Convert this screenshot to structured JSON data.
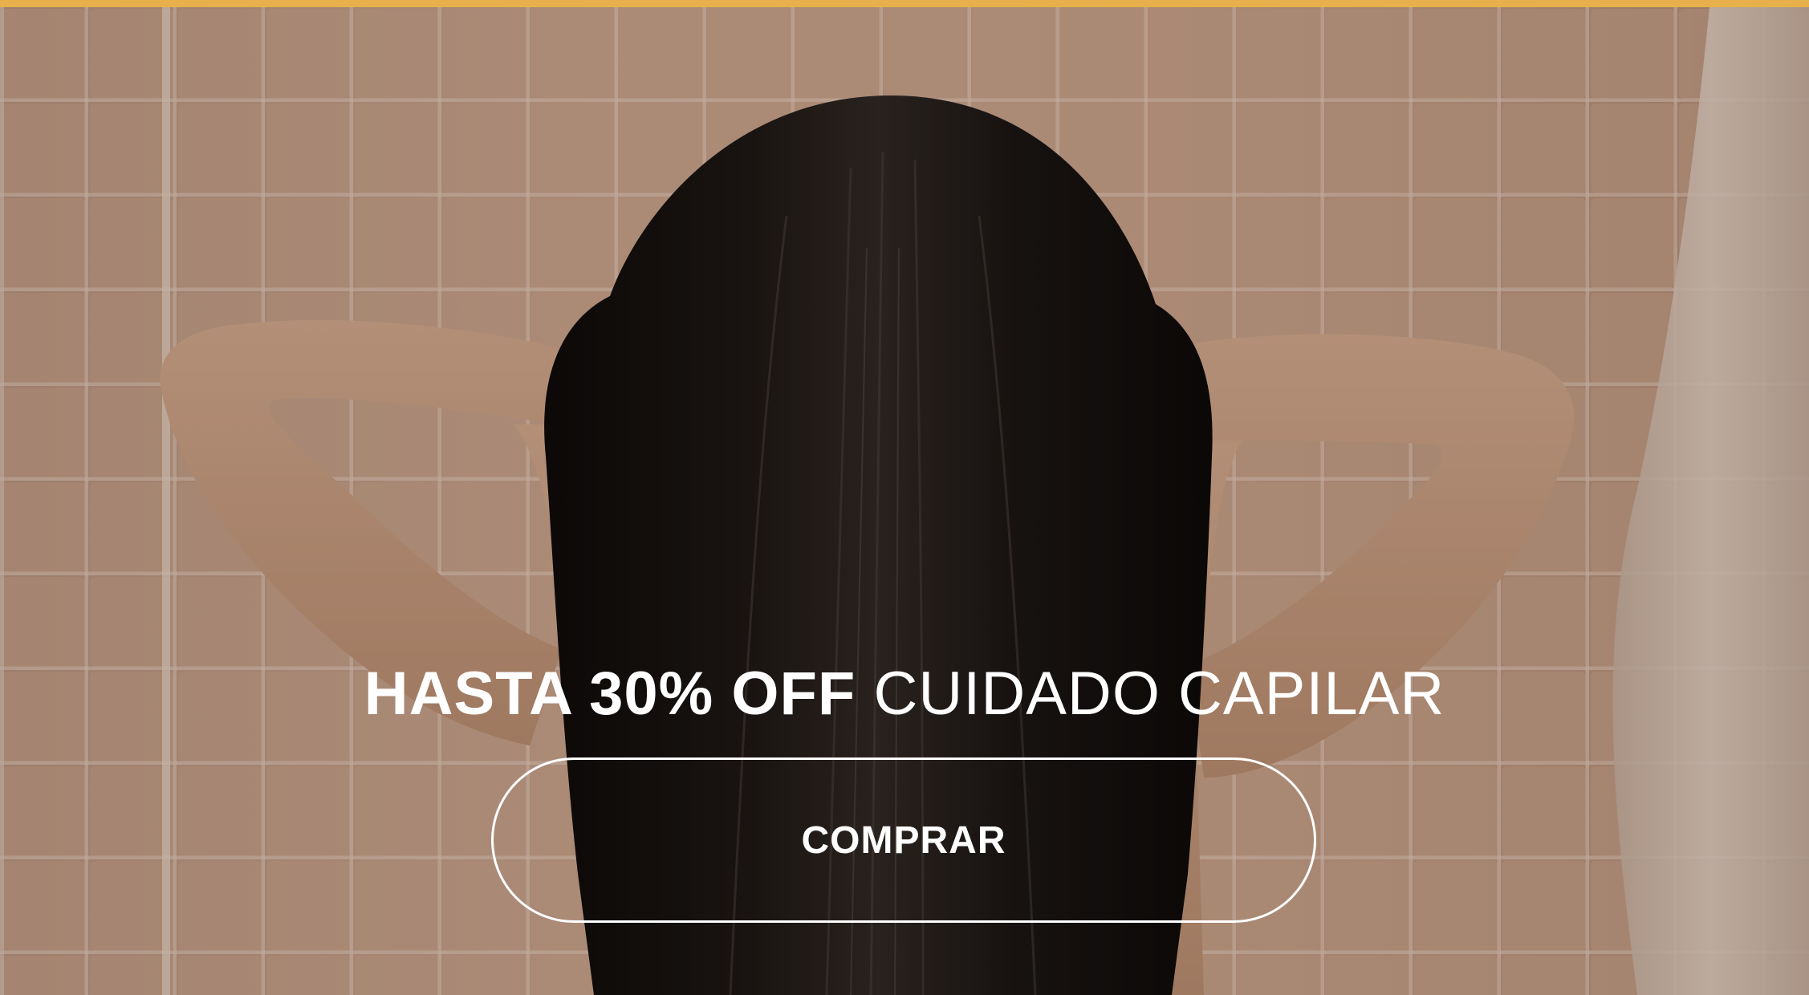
{
  "promo": {
    "headline_bold": "HASTA 30% OFF",
    "headline_light": "CUIDADO CAPILAR",
    "cta_label": "COMPRAR"
  },
  "colors": {
    "accent_bar": "#e8b04a",
    "text": "#ffffff",
    "hair": "#0b0908",
    "tile": "#c9a48c",
    "skin": "#c4987c"
  }
}
